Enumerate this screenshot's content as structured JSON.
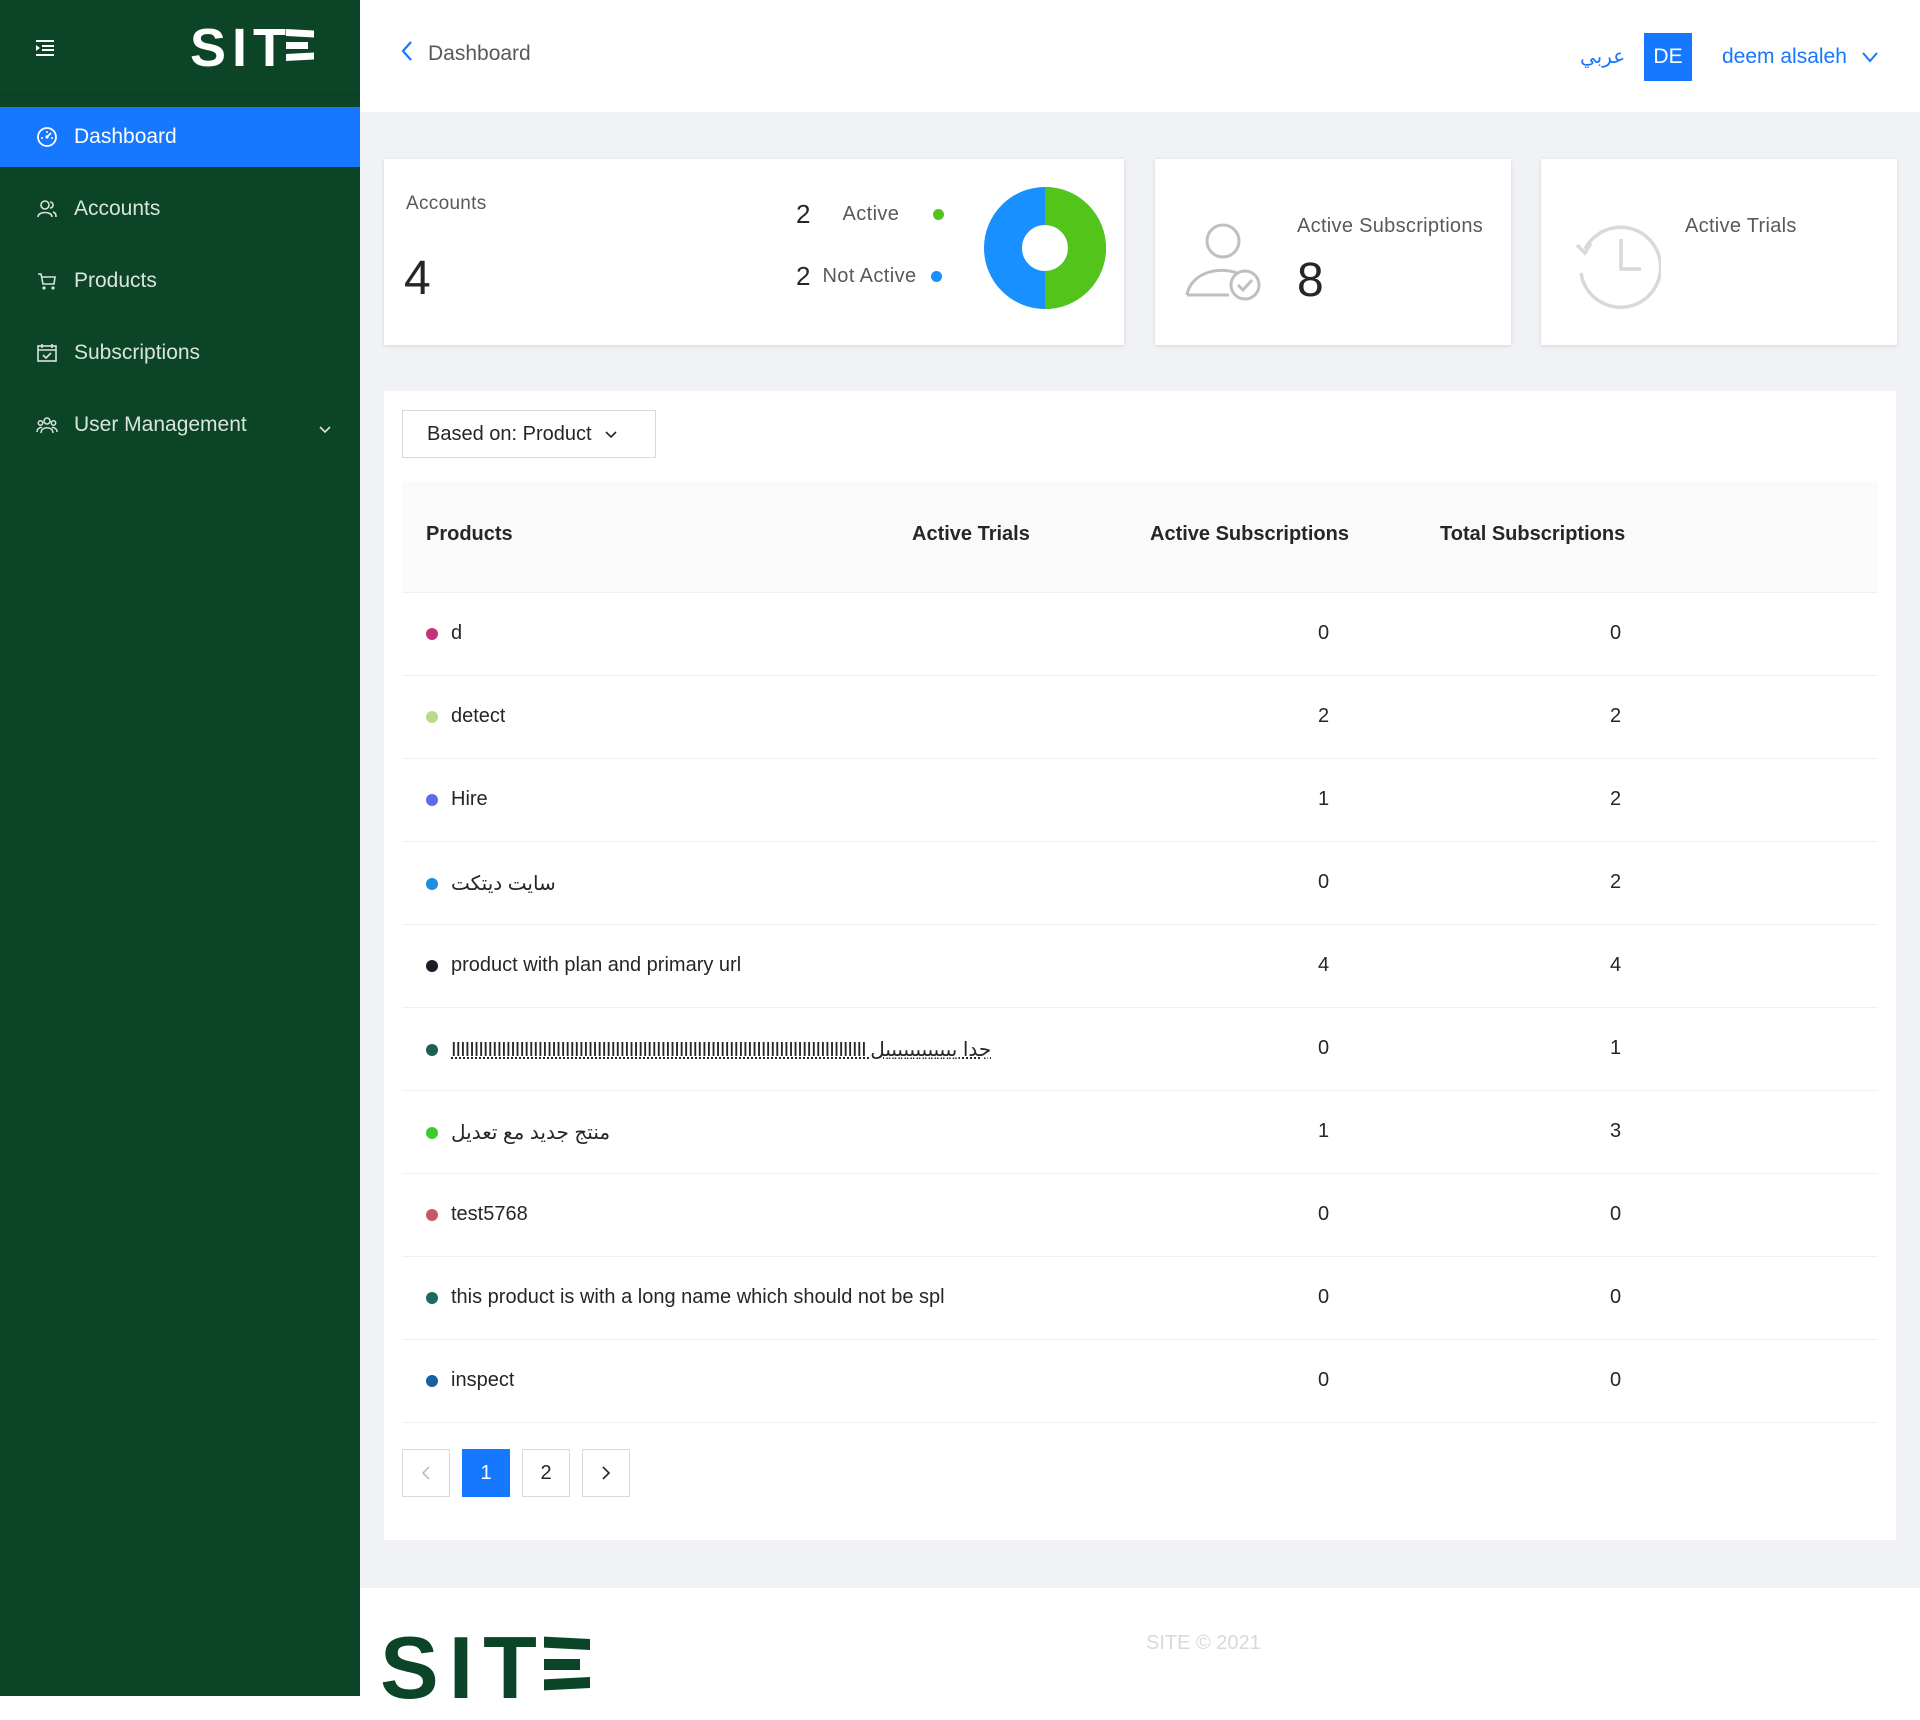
{
  "brand": {
    "logo_text": "SITE",
    "logo_color": "#0b4426",
    "accent": "#1677ff"
  },
  "sidebar": {
    "items": [
      {
        "label": "Dashboard",
        "icon": "dashboard-gauge-icon"
      },
      {
        "label": "Accounts",
        "icon": "users-icon"
      },
      {
        "label": "Products",
        "icon": "cart-icon"
      },
      {
        "label": "Subscriptions",
        "icon": "calendar-check-icon"
      },
      {
        "label": "User Management",
        "icon": "team-icon"
      }
    ]
  },
  "header": {
    "back_label": "Dashboard",
    "language_toggle": "عربي",
    "avatar_initials": "DE",
    "user_name": "deem alsaleh"
  },
  "cards": {
    "accounts": {
      "title": "Accounts",
      "total": "4",
      "active_count": "2",
      "active_label": "Active",
      "inactive_count": "2",
      "inactive_label": "Not Active",
      "active_color": "#52c41a",
      "inactive_color": "#1890ff",
      "active_share": 0.5
    },
    "subscriptions": {
      "label": "Active Subscriptions",
      "value": "8"
    },
    "trials": {
      "label": "Active Trials",
      "value": ""
    }
  },
  "filter": {
    "label": "Based on: Product"
  },
  "table": {
    "columns": [
      "Products",
      "Active Trials",
      "Active Subscriptions",
      "Total Subscriptions"
    ],
    "rows": [
      {
        "name": "d",
        "color": "#c4327a",
        "trials": "",
        "active": "0",
        "total": "0"
      },
      {
        "name": "detect",
        "color": "#b7db8a",
        "trials": "",
        "active": "2",
        "total": "2"
      },
      {
        "name": "Hire",
        "color": "#5b6ee6",
        "trials": "",
        "active": "1",
        "total": "2"
      },
      {
        "name": "سايت ديتكت",
        "color": "#1c8fe0",
        "trials": "",
        "active": "0",
        "total": "2"
      },
      {
        "name": "product with plan and primary url",
        "color": "#1f1a24",
        "trials": "",
        "active": "4",
        "total": "4"
      },
      {
        "name": "IIIIIIIIIIIIIIIIIIIIIIIIIIIIIIIIIIIIIIIIIIIIIIIIIIIIIIIIIIIIIIIIIIIIIIIIIIIIIIIIIIIIIIIIIII جدا ييييييييييييل",
        "color": "#1d5e57",
        "trials": "",
        "active": "0",
        "total": "1"
      },
      {
        "name": "منتج جديد مع تعديل",
        "color": "#3ccc2e",
        "trials": "",
        "active": "1",
        "total": "3"
      },
      {
        "name": "test5768",
        "color": "#c7586a",
        "trials": "",
        "active": "0",
        "total": "0"
      },
      {
        "name": "this product is with a long name which should not be spl",
        "color": "#1a6b62",
        "trials": "",
        "active": "0",
        "total": "0"
      },
      {
        "name": "inspect",
        "color": "#17629e",
        "trials": "",
        "active": "0",
        "total": "0"
      }
    ]
  },
  "pagination": {
    "pages": [
      "1",
      "2"
    ],
    "current": "1"
  },
  "footer": {
    "copyright": "SITE © 2021"
  }
}
